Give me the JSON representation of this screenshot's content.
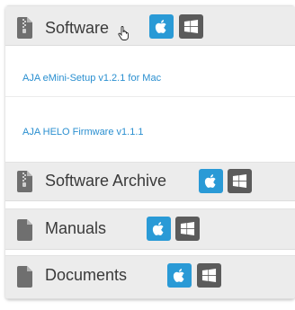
{
  "sections": [
    {
      "label": "Software",
      "icon": "zip-file-icon",
      "downloads": [
        {
          "label": "AJA eMini-Setup v1.2.1 for Mac"
        },
        {
          "label": "AJA HELO Firmware v1.1.1"
        }
      ]
    },
    {
      "label": "Software Archive",
      "icon": "zip-file-icon"
    },
    {
      "label": "Manuals",
      "icon": "document-icon"
    },
    {
      "label": "Documents",
      "icon": "document-icon"
    }
  ],
  "platform_buttons": {
    "mac_icon": "apple-icon",
    "windows_icon": "windows-icon"
  },
  "colors": {
    "mac_button": "#2a9ad6",
    "windows_button": "#5b5b5b",
    "link": "#2a8fd0",
    "header_bg": "#ececec"
  }
}
